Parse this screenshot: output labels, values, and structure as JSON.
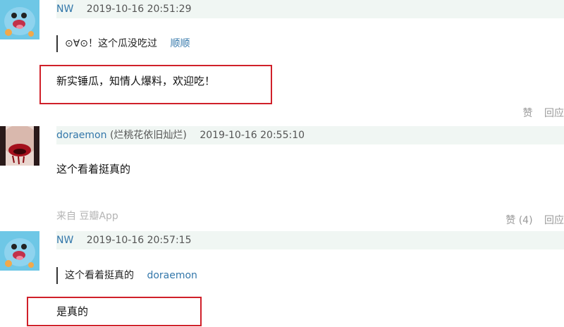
{
  "comments": [
    {
      "author": "NW",
      "time": "2019-10-16 20:51:29",
      "quote_text": "⊙∀⊙！这个瓜没吃过",
      "quote_author": "顺顺",
      "text": "新实锤瓜，知情人爆料，欢迎吃！",
      "like_label": "赞",
      "reply_label": "回应"
    },
    {
      "author": "doraemon",
      "nickname": "(烂桃花依旧灿烂)",
      "time": "2019-10-16 20:55:10",
      "text": "这个看着挺真的",
      "source": "来自 豆瓣App",
      "like_label": "赞 (4)",
      "reply_label": "回应"
    },
    {
      "author": "NW",
      "time": "2019-10-16 20:57:15",
      "quote_text": "这个看着挺真的",
      "quote_author": "doraemon",
      "text": "是真的"
    }
  ],
  "colors": {
    "link": "#3377aa",
    "meta_bg": "#f0f6f3",
    "highlight": "#d0202a",
    "muted": "#999999"
  },
  "icons": {
    "avatar_nw": "squirtle-avatar",
    "avatar_doraemon": "red-lips-avatar"
  }
}
